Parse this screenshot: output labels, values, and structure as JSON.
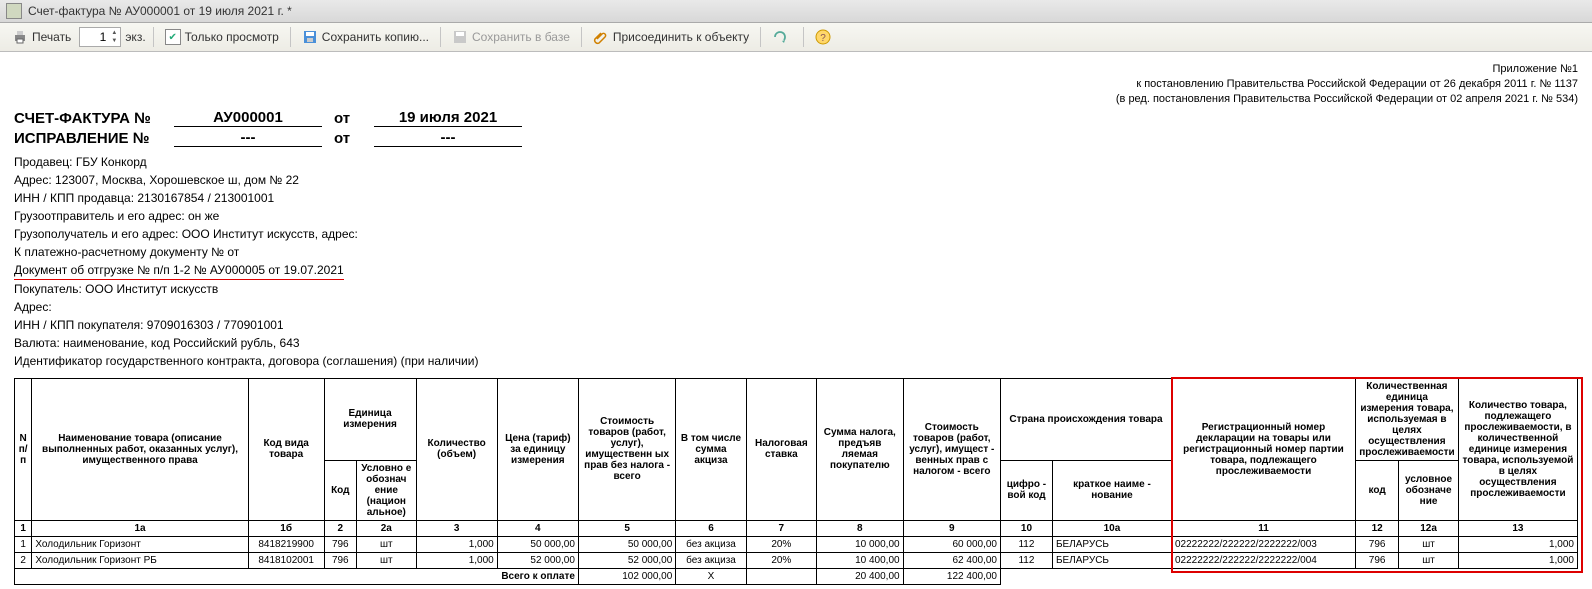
{
  "window": {
    "title": "Счет-фактура № АУ000001 от 19 июля 2021 г. *"
  },
  "toolbar": {
    "print": "Печать",
    "copies_value": "1",
    "copies_suffix": "экз.",
    "preview": "Только просмотр",
    "save_copy": "Сохранить копию...",
    "save_db": "Сохранить в базе",
    "attach": "Присоединить к объекту"
  },
  "annex": {
    "l1": "Приложение №1",
    "l2": "к постановлению Правительства Российской Федерации от 26 декабря 2011 г. № 1137",
    "l3": "(в ред. постановления Правительства Российской Федерации от 02 апреля 2021 г. № 534)"
  },
  "head": {
    "invoice_label": "СЧЕТ-ФАКТУРА №",
    "invoice_no": "АУ000001",
    "from": "от",
    "invoice_date": "19 июля 2021",
    "correction_label": "ИСПРАВЛЕНИЕ №",
    "correction_no": "---",
    "correction_date": "---"
  },
  "info": {
    "seller": "Продавец: ГБУ Конкорд",
    "addr": "Адрес: 123007, Москва, Хорошевское ш, дом № 22",
    "inn": "ИНН / КПП продавца: 2130167854 / 213001001",
    "shipper": "Грузоотправитель и его адрес: он же",
    "consignee": "Грузополучатель и его адрес: ООО Институт искусств, адрес:",
    "paydoc": "К платежно-расчетному документу №             от",
    "shipdoc": "Документ об отгрузке № п/п 1-2 № АУ000005 от 19.07.2021",
    "buyer": "Покупатель: ООО Институт искусств",
    "buyer_addr": "Адрес:",
    "buyer_inn": "ИНН / КПП покупателя: 9709016303 / 770901001",
    "currency": "Валюта: наименование, код Российский рубль, 643",
    "contract": "Идентификатор государственного контракта, договора (соглашения) (при наличии)"
  },
  "th": {
    "npp": "N п/п",
    "name": "Наименование товара (описание выполненных работ, оказанных услуг), имущественного права",
    "code": "Код вида товара",
    "unit": "Единица измерения",
    "unit_code": "Код",
    "unit_name": "Условно е обознач ение (национ альное)",
    "qty": "Количество (объем)",
    "price": "Цена (тариф) за единицу измерения",
    "cost": "Стоимость товаров (работ, услуг), имущественн ых прав без налога - всего",
    "excise": "В том числе сумма акциза",
    "rate": "Налоговая ставка",
    "tax": "Сумма налога, предъяв ляемая покупателю",
    "total": "Стоимость товаров (работ, услуг), имущест - венных прав с налогом - всего",
    "origin": "Страна происхождения товара",
    "origin_code": "цифро - вой код",
    "origin_name": "краткое наиме - нование",
    "decl": "Регистрационный номер декларации на товары или регистрационный номер партии товара, подлежащего прослеживаемости",
    "trace_unit": "Количественная единица измерения товара, используемая в целях осуществления прослеживаемости",
    "trace_code": "код",
    "trace_name": "условное обозначе ние",
    "trace_qty": "Количество товара, подлежащего прослеживаемости, в количественной единице измерения товара, используемой в целях осуществления прослеживаемости"
  },
  "colnums": {
    "c0": "1",
    "c1": "1а",
    "c2": "1б",
    "c3": "2",
    "c4": "2а",
    "c5": "3",
    "c6": "4",
    "c7": "5",
    "c8": "6",
    "c9": "7",
    "c10": "8",
    "c11": "9",
    "c12": "10",
    "c13": "10а",
    "c14": "11",
    "c15": "12",
    "c16": "12а",
    "c17": "13"
  },
  "rows": [
    {
      "n": "1",
      "name": "Холодильник Горизонт",
      "code": "8418219900",
      "ucode": "796",
      "uname": "шт",
      "qty": "1,000",
      "price": "50 000,00",
      "cost": "50 000,00",
      "exc": "без акциза",
      "rate": "20%",
      "tax": "10 000,00",
      "total": "60 000,00",
      "ocode": "112",
      "oname": "БЕЛАРУСЬ",
      "decl": "02222222/222222/2222222/003",
      "tcode": "796",
      "tname": "шт",
      "tqty": "1,000"
    },
    {
      "n": "2",
      "name": "Холодильник Горизонт РБ",
      "code": "8418102001",
      "ucode": "796",
      "uname": "шт",
      "qty": "1,000",
      "price": "52 000,00",
      "cost": "52 000,00",
      "exc": "без акциза",
      "rate": "20%",
      "tax": "10 400,00",
      "total": "62 400,00",
      "ocode": "112",
      "oname": "БЕЛАРУСЬ",
      "decl": "02222222/222222/2222222/004",
      "tcode": "796",
      "tname": "шт",
      "tqty": "1,000"
    }
  ],
  "totals": {
    "label": "Всего к оплате",
    "cost": "102 000,00",
    "exc": "Х",
    "tax": "20 400,00",
    "total": "122 400,00"
  }
}
